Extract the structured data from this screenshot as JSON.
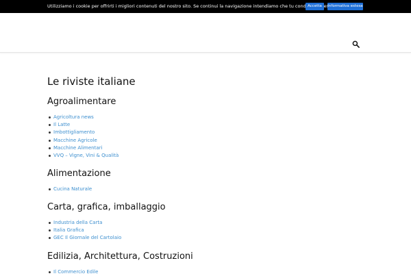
{
  "cookie_bar": {
    "text": "Utilizziamo i cookie per offrirti i migliori contenuti del nostro sito. Se continui la navigazione intendiamo che tu condivida questo utilizzo.",
    "accept_label": "Accetta",
    "info_label": "Informativa estesa",
    "background_color": "#000000",
    "button_color": "#1f6fd6"
  },
  "header": {
    "search_icon": "search-icon"
  },
  "page": {
    "title": "Le riviste italiane",
    "link_color": "#3d8fcf",
    "sections": [
      {
        "title": "Agroalimentare",
        "items": [
          "Agricoltura news",
          "Il Latte",
          "Imbottigliamento",
          "Macchine Agricole",
          "Macchine Alimentari",
          "VVQ – Vigne, Vini & Qualità"
        ]
      },
      {
        "title": "Alimentazione",
        "items": [
          "Cucina Naturale"
        ]
      },
      {
        "title": "Carta, grafica, imballaggio",
        "items": [
          "Industria della Carta",
          "Italia Grafica",
          "GEC Il Giornale del Cartolaio"
        ]
      },
      {
        "title": "Edilizia, Architettura, Costruzioni",
        "items": [
          "Il Commercio Edile"
        ]
      }
    ]
  }
}
